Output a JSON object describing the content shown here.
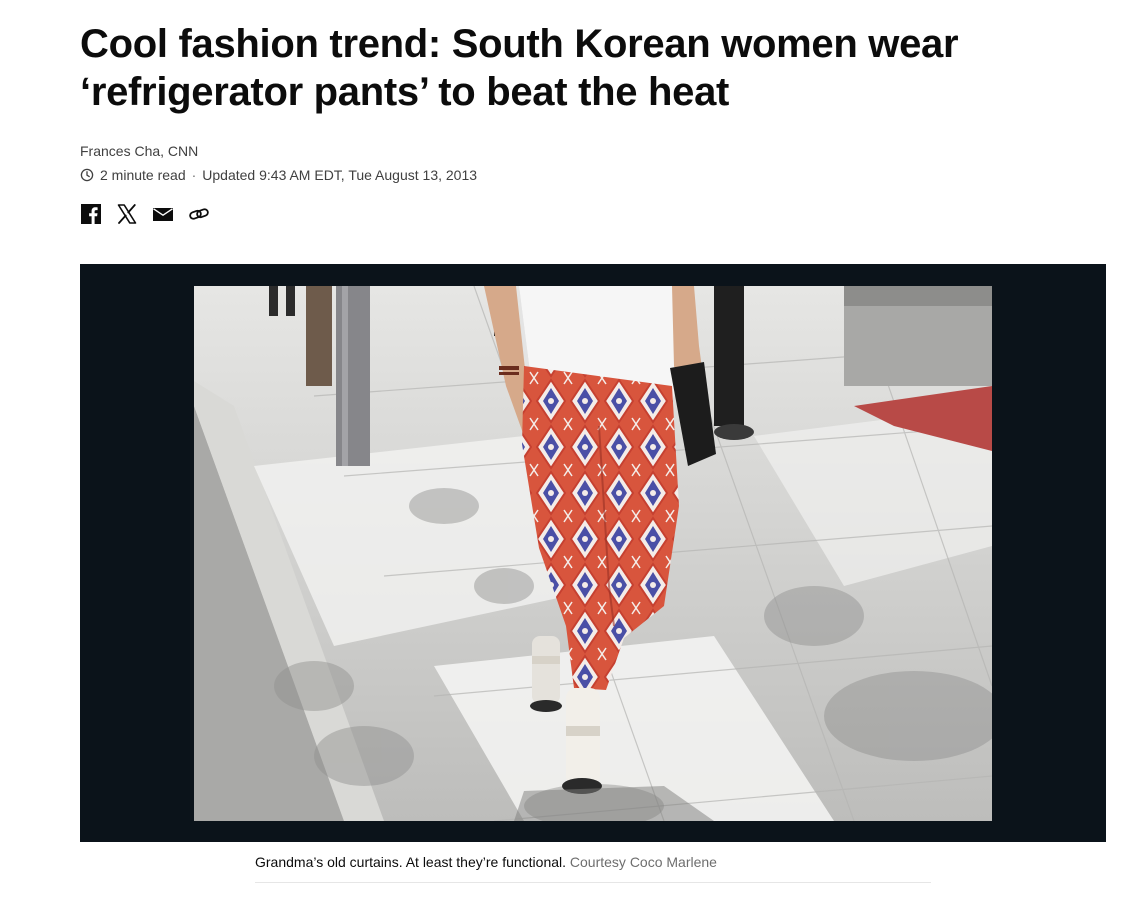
{
  "article": {
    "headline": "Cool fashion trend: South Korean women wear ‘refrigerator pants’ to beat the heat",
    "byline": "Frances Cha, CNN",
    "read_time": "2 minute read",
    "updated": "Updated 9:43 AM EDT, Tue August 13, 2013"
  },
  "share": {
    "icons": [
      "facebook-icon",
      "x-icon",
      "email-icon",
      "link-icon"
    ]
  },
  "media": {
    "caption": "Grandma’s old curtains. At least they’re functional.",
    "credit": "Courtesy Coco Marlene"
  },
  "colors": {
    "text": "#0c0c0c",
    "meta": "#404040",
    "credit": "#6e6e6e",
    "media_bg": "#0b131a",
    "pants_red": "#d8553d",
    "pants_blue": "#4a4fa6"
  }
}
